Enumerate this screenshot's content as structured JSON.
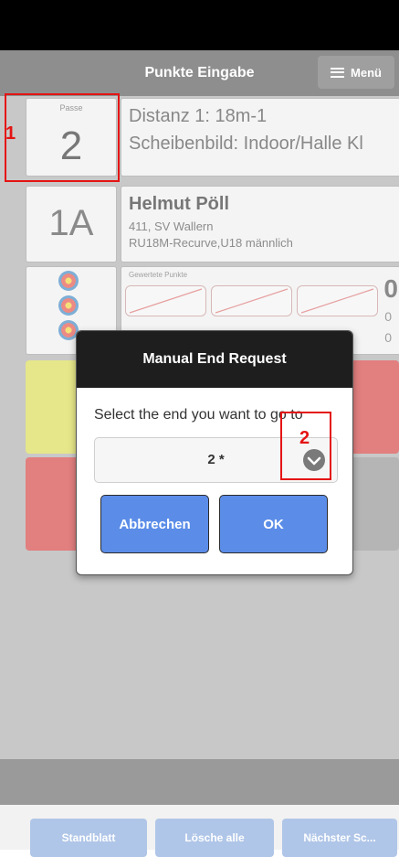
{
  "toolbar": {
    "title": "Punkte Eingabe",
    "menu_label": "Menü",
    "menu_icon": "hamburger-icon"
  },
  "passe": {
    "label": "Passe",
    "number": "2"
  },
  "distance": {
    "line1": "Distanz 1: 18m-1",
    "line2": "Scheibenbild: Indoor/Halle Kl"
  },
  "athlete": {
    "code": "1A",
    "name": "Helmut Pöll",
    "club": "411, SV Wallern",
    "class": "RU18M-Recurve,U18 männlich"
  },
  "scores": {
    "label": "Gewertete Punkte",
    "total": "0",
    "sub1": "0",
    "sub2": "0",
    "slots_empty": 3
  },
  "dialog": {
    "title": "Manual End Request",
    "message": "Select the end you want to go to",
    "selected_value": "2 *",
    "cancel_label": "Abbrechen",
    "ok_label": "OK"
  },
  "footer": {
    "buttons": [
      "Standblatt",
      "Lösche alle",
      "Nächster Sc..."
    ]
  },
  "annotations": {
    "marker1": "1",
    "marker2": "2"
  },
  "colors": {
    "accent_button": "#5b8de8",
    "annotation": "#e41414",
    "key_yellow": "#e6e68a",
    "key_red": "#e27f7f"
  }
}
